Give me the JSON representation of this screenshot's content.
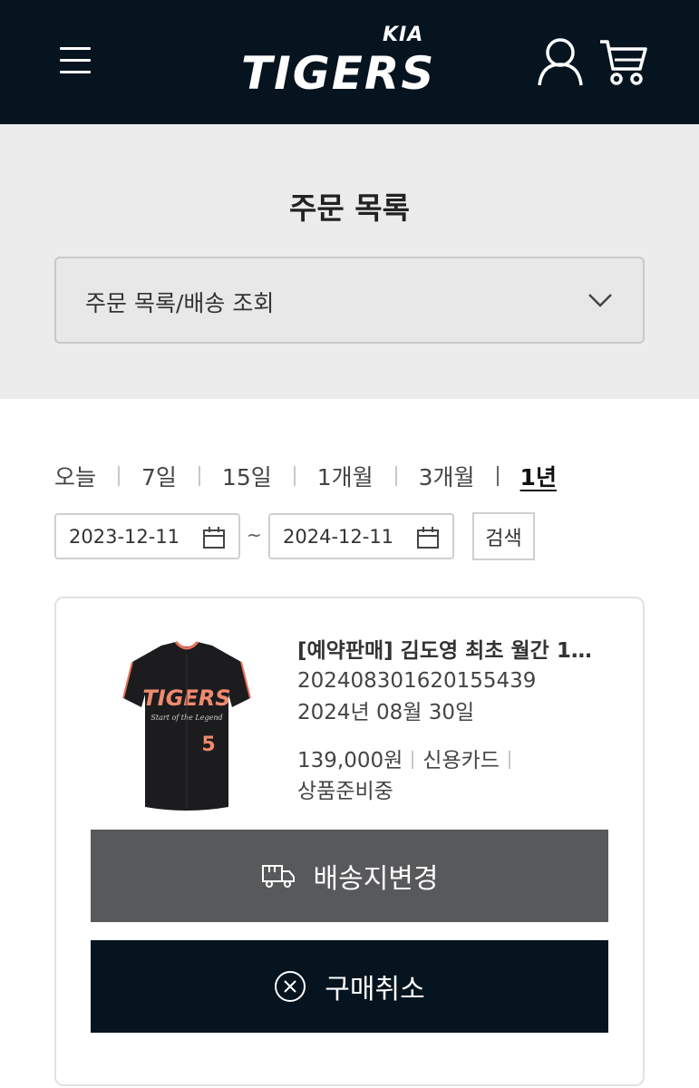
{
  "header": {
    "logo_text": "TIGERS",
    "logo_sub": "KIA"
  },
  "page": {
    "title": "주문 목록",
    "select_value": "주문 목록/배송 조회"
  },
  "periods": [
    "오늘",
    "7일",
    "15일",
    "1개월",
    "3개월",
    "1년"
  ],
  "active_period": "1년",
  "date_range": {
    "start": "2023-12-11",
    "separator": "~",
    "end": "2024-12-11",
    "search_label": "검색"
  },
  "order": {
    "product_name": "[예약판매] 김도영 최초 월간 1…",
    "order_number": "20240830162015543​9",
    "order_date": "2024년 08월 30일",
    "price": "139,000원",
    "payment": "신용카드",
    "status": "상품준비중",
    "jersey_text": "TIGERS",
    "jersey_tagline": "Start of the Legend",
    "jersey_number": "5",
    "change_address_label": "배송지변경",
    "cancel_label": "구매취소"
  },
  "colors": {
    "header_bg": "#05141f",
    "gray_button": "#58595b",
    "dark_button": "#05141f",
    "panel_bg": "#ececec"
  }
}
